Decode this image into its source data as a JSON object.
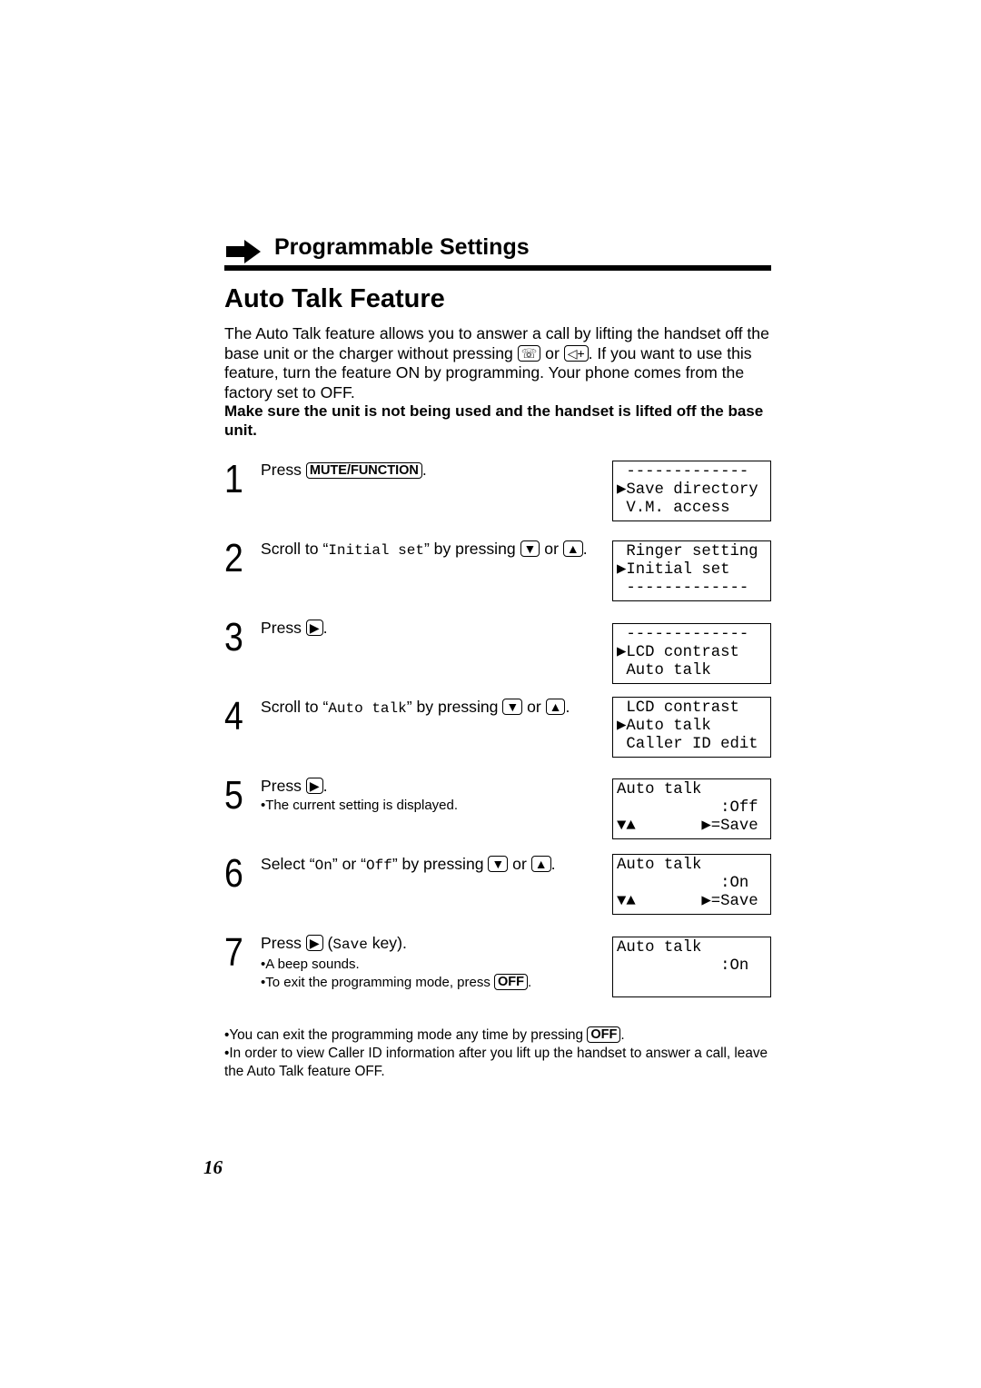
{
  "section": {
    "title": "Programmable Settings",
    "icon": "right-arrow-icon"
  },
  "title": "Auto Talk Feature",
  "intro": [
    {
      "t": "text",
      "v": "The Auto Talk feature allows you to answer a call by lifting the handset off the base unit or the charger without pressing "
    },
    {
      "t": "key",
      "v": "☏",
      "name": "talk-key-icon"
    },
    {
      "t": "text",
      "v": " or "
    },
    {
      "t": "key",
      "v": "◁+",
      "name": "speaker-key-icon"
    },
    {
      "t": "text",
      "v": ". If you want to use this feature, turn the feature ON by programming. Your phone comes from the factory set to OFF."
    }
  ],
  "warning": "Make sure the unit is not being used and the handset is lifted off the base unit.",
  "steps": [
    {
      "num": "1",
      "lines": [
        [
          {
            "t": "text",
            "v": "Press "
          },
          {
            "t": "word",
            "v": "MUTE/FUNCTION"
          },
          {
            "t": "text",
            "v": "."
          }
        ]
      ],
      "lcd": [
        " -------------",
        "▶Save directory",
        " V.M. access"
      ]
    },
    {
      "num": "2",
      "lines": [
        [
          {
            "t": "text",
            "v": "Scroll to “"
          },
          {
            "t": "mono",
            "v": "Initial set"
          },
          {
            "t": "text",
            "v": "” by pressing "
          },
          {
            "t": "key",
            "v": "▼",
            "name": "down-key-icon"
          },
          {
            "t": "text",
            "v": " or "
          },
          {
            "t": "key",
            "v": "▲",
            "name": "up-key-icon"
          },
          {
            "t": "text",
            "v": "."
          }
        ]
      ],
      "lcd": [
        " Ringer setting",
        "▶Initial set",
        " -------------"
      ]
    },
    {
      "num": "3",
      "lines": [
        [
          {
            "t": "text",
            "v": "Press "
          },
          {
            "t": "key",
            "v": "▶",
            "name": "right-key-icon"
          },
          {
            "t": "text",
            "v": "."
          }
        ]
      ],
      "lcd": [
        " -------------",
        "▶LCD contrast",
        " Auto talk"
      ]
    },
    {
      "num": "4",
      "lines": [
        [
          {
            "t": "text",
            "v": "Scroll to “"
          },
          {
            "t": "mono",
            "v": "Auto talk"
          },
          {
            "t": "text",
            "v": "” by pressing "
          },
          {
            "t": "key",
            "v": "▼",
            "name": "down-key-icon"
          },
          {
            "t": "text",
            "v": " or "
          },
          {
            "t": "key",
            "v": "▲",
            "name": "up-key-icon"
          },
          {
            "t": "text",
            "v": "."
          }
        ]
      ],
      "lcd": [
        " LCD contrast",
        "▶Auto talk",
        " Caller ID edit"
      ]
    },
    {
      "num": "5",
      "lines": [
        [
          {
            "t": "text",
            "v": "Press "
          },
          {
            "t": "key",
            "v": "▶",
            "name": "right-key-icon"
          },
          {
            "t": "text",
            "v": "."
          }
        ],
        [
          {
            "t": "note",
            "v": "•The current setting is displayed."
          }
        ]
      ],
      "lcd": [
        "Auto talk",
        "           :Off",
        "▼▲       ▶=Save"
      ]
    },
    {
      "num": "6",
      "lines": [
        [
          {
            "t": "text",
            "v": "Select “"
          },
          {
            "t": "mono",
            "v": "On"
          },
          {
            "t": "text",
            "v": "” or “"
          },
          {
            "t": "mono",
            "v": "Off"
          },
          {
            "t": "text",
            "v": "” by pressing "
          },
          {
            "t": "key",
            "v": "▼",
            "name": "down-key-icon"
          },
          {
            "t": "text",
            "v": " or "
          },
          {
            "t": "key",
            "v": "▲",
            "name": "up-key-icon"
          },
          {
            "t": "text",
            "v": "."
          }
        ]
      ],
      "lcd": [
        "Auto talk",
        "           :On",
        "▼▲       ▶=Save"
      ]
    },
    {
      "num": "7",
      "lines": [
        [
          {
            "t": "text",
            "v": "Press "
          },
          {
            "t": "key",
            "v": "▶",
            "name": "right-key-icon"
          },
          {
            "t": "text",
            "v": " ("
          },
          {
            "t": "mono",
            "v": "Save"
          },
          {
            "t": "text",
            "v": " key)."
          }
        ],
        [
          {
            "t": "note",
            "v": "•A beep sounds."
          }
        ],
        [
          {
            "t": "note",
            "v": "•To exit the programming mode, press "
          },
          {
            "t": "word",
            "v": "OFF"
          },
          {
            "t": "note",
            "v": "."
          }
        ]
      ],
      "lcd": [
        "Auto talk",
        "           :On"
      ]
    }
  ],
  "footnotes": [
    [
      {
        "t": "text",
        "v": "•You can exit the programming mode any time by pressing "
      },
      {
        "t": "word",
        "v": "OFF"
      },
      {
        "t": "text",
        "v": "."
      }
    ],
    [
      {
        "t": "text",
        "v": "•In order to view Caller ID information after you lift up the handset to answer a call, leave the Auto Talk feature OFF."
      }
    ]
  ],
  "page_number": "16"
}
